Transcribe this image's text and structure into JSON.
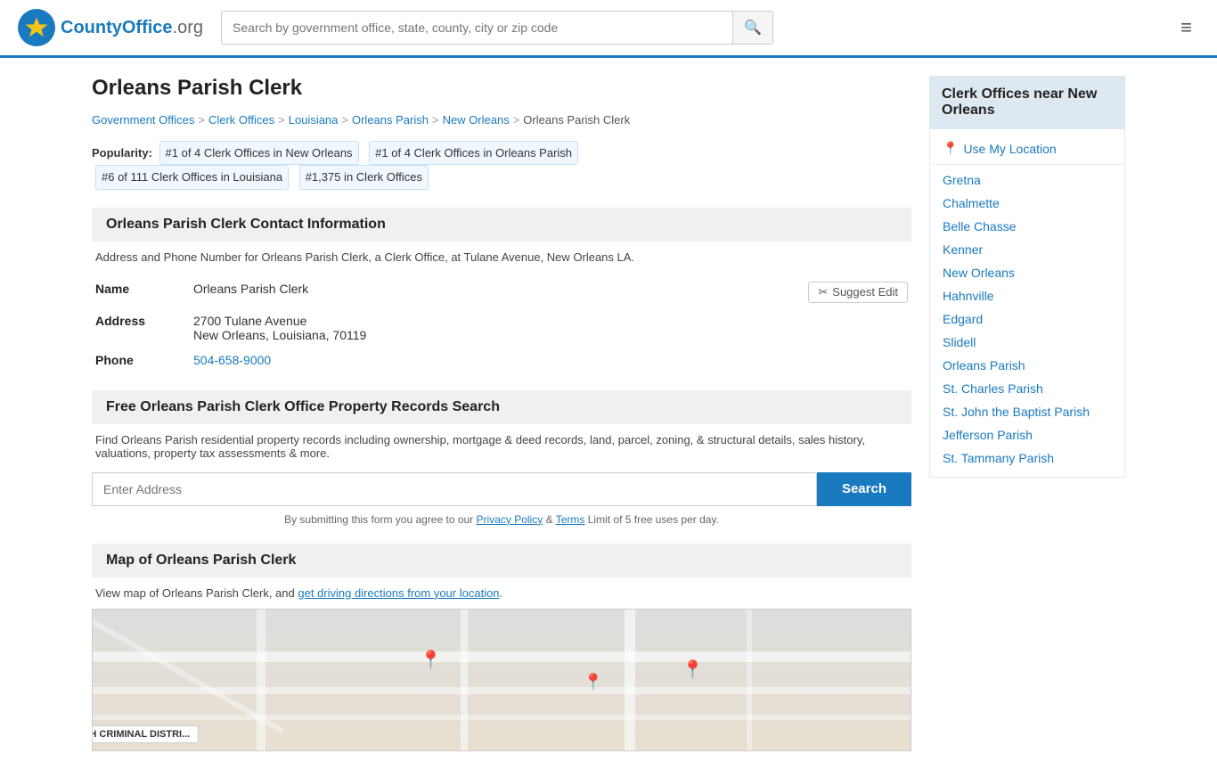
{
  "header": {
    "logo_text": "CountyOffice",
    "logo_suffix": ".org",
    "search_placeholder": "Search by government office, state, county, city or zip code"
  },
  "breadcrumb": {
    "items": [
      {
        "label": "Government Offices",
        "href": "#"
      },
      {
        "label": "Clerk Offices",
        "href": "#"
      },
      {
        "label": "Louisiana",
        "href": "#"
      },
      {
        "label": "Orleans Parish",
        "href": "#"
      },
      {
        "label": "New Orleans",
        "href": "#"
      },
      {
        "label": "Orleans Parish Clerk",
        "href": "#"
      }
    ]
  },
  "page": {
    "title": "Orleans Parish Clerk"
  },
  "popularity": {
    "label": "Popularity:",
    "badges": [
      "#1 of 4 Clerk Offices in New Orleans",
      "#1 of 4 Clerk Offices in Orleans Parish",
      "#6 of 111 Clerk Offices in Louisiana",
      "#1,375 in Clerk Offices"
    ]
  },
  "contact_section": {
    "title": "Orleans Parish Clerk Contact Information",
    "description": "Address and Phone Number for Orleans Parish Clerk, a Clerk Office, at Tulane Avenue, New Orleans LA.",
    "name_label": "Name",
    "name_value": "Orleans Parish Clerk",
    "address_label": "Address",
    "address_line1": "2700 Tulane Avenue",
    "address_line2": "New Orleans, Louisiana, 70119",
    "phone_label": "Phone",
    "phone_value": "504-658-9000",
    "suggest_edit": "Suggest Edit"
  },
  "property_section": {
    "title": "Free Orleans Parish Clerk Office Property Records Search",
    "description": "Find Orleans Parish residential property records including ownership, mortgage & deed records, land, parcel, zoning, & structural details, sales history, valuations, property tax assessments & more.",
    "input_placeholder": "Enter Address",
    "search_button": "Search",
    "disclaimer": "By submitting this form you agree to our",
    "privacy_policy": "Privacy Policy",
    "and_text": "&",
    "terms": "Terms",
    "limit_text": "Limit of 5 free uses per day."
  },
  "map_section": {
    "title": "Map of Orleans Parish Clerk",
    "description": "View map of Orleans Parish Clerk, and",
    "directions_link": "get driving directions from your location",
    "map_label": "ORLEANS PARISH CRIMINAL DISTRI..."
  },
  "sidebar": {
    "title": "Clerk Offices near New Orleans",
    "use_my_location": "Use My Location",
    "items": [
      {
        "label": "Gretna",
        "href": "#"
      },
      {
        "label": "Chalmette",
        "href": "#"
      },
      {
        "label": "Belle Chasse",
        "href": "#"
      },
      {
        "label": "Kenner",
        "href": "#"
      },
      {
        "label": "New Orleans",
        "href": "#"
      },
      {
        "label": "Hahnville",
        "href": "#"
      },
      {
        "label": "Edgard",
        "href": "#"
      },
      {
        "label": "Slidell",
        "href": "#"
      },
      {
        "label": "Orleans Parish",
        "href": "#"
      },
      {
        "label": "St. Charles Parish",
        "href": "#"
      },
      {
        "label": "St. John the Baptist Parish",
        "href": "#"
      },
      {
        "label": "Jefferson Parish",
        "href": "#"
      },
      {
        "label": "St. Tammany Parish",
        "href": "#"
      }
    ]
  }
}
